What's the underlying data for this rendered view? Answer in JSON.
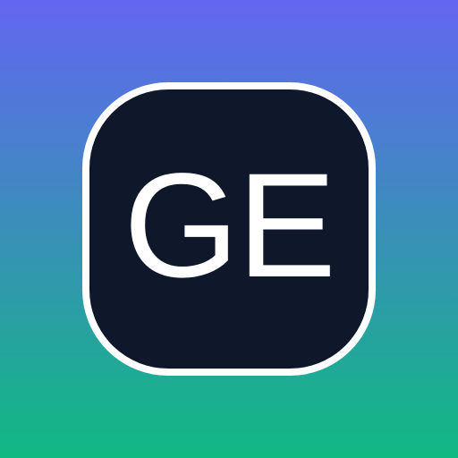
{
  "logo": {
    "initials": "GE"
  },
  "colors": {
    "gradient_top": "#6366f1",
    "gradient_bottom": "#10b981",
    "badge_fill": "#0f172a",
    "badge_border": "#ffffff",
    "text": "#ffffff"
  }
}
